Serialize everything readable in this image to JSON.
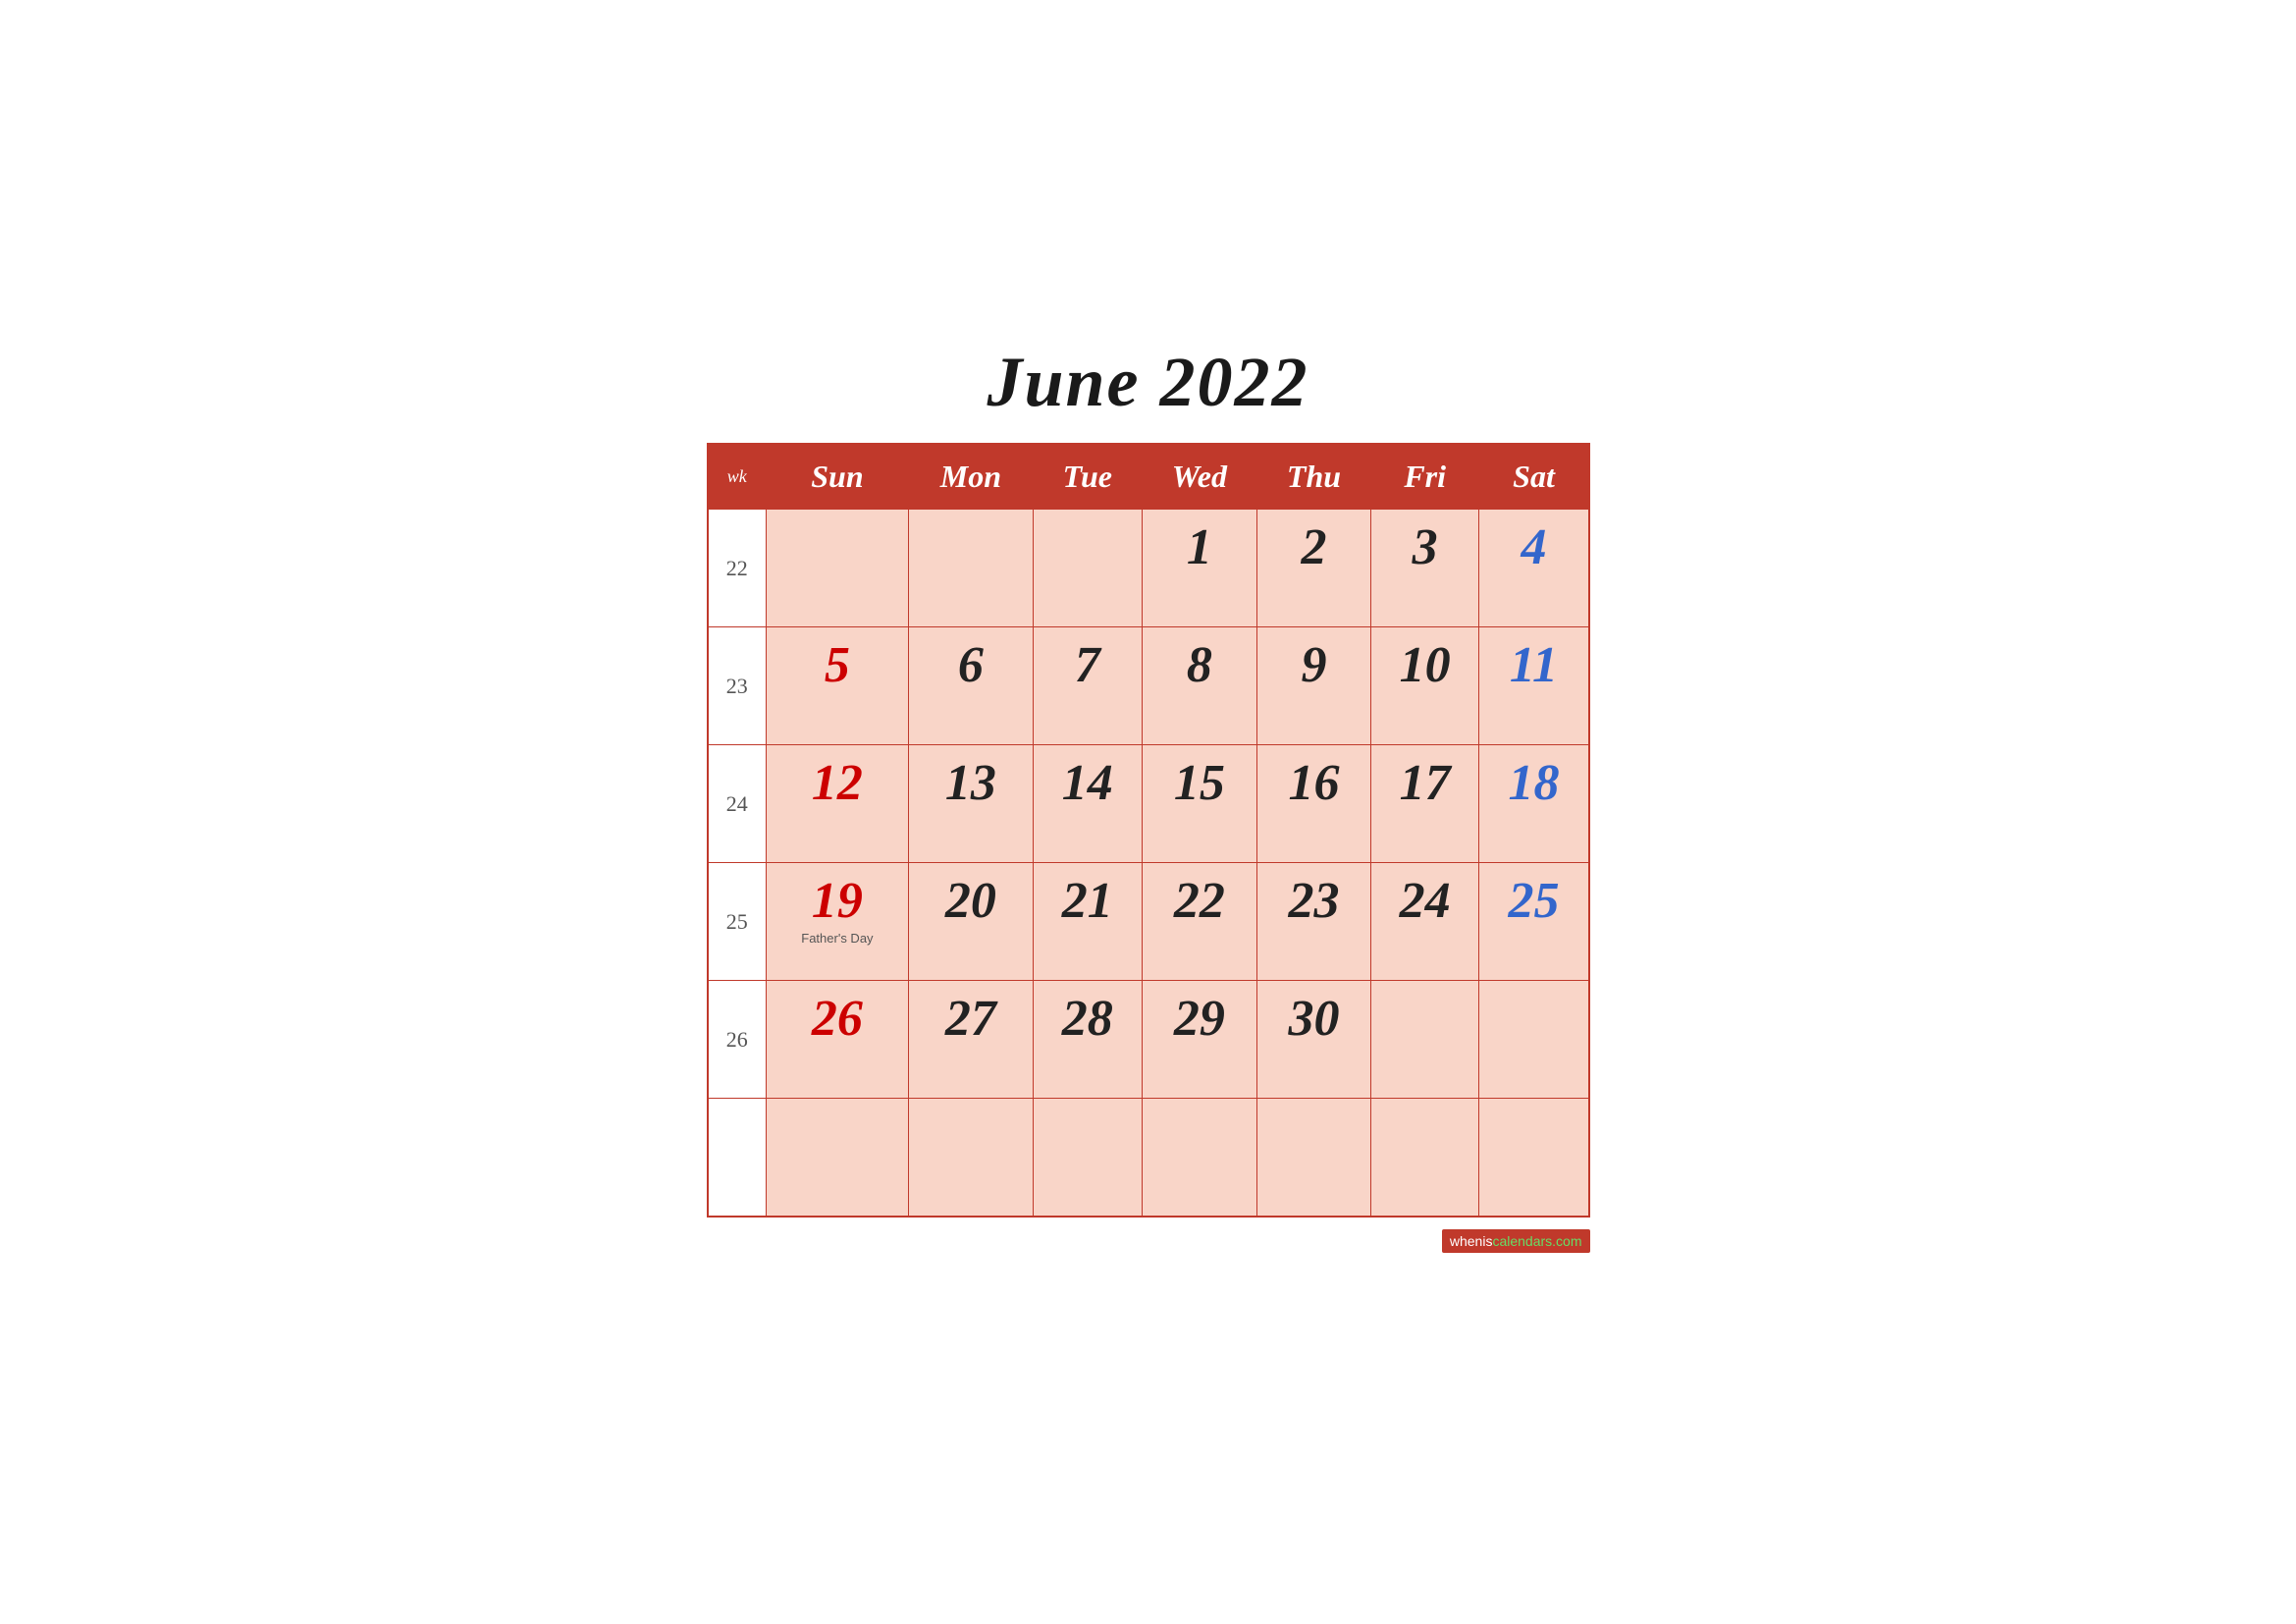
{
  "title": "June 2022",
  "header": {
    "wk": "wk",
    "days": [
      "Sun",
      "Mon",
      "Tue",
      "Wed",
      "Thu",
      "Fri",
      "Sat"
    ]
  },
  "weeks": [
    {
      "wk": "22",
      "days": [
        {
          "num": "",
          "color": "dark",
          "label": ""
        },
        {
          "num": "",
          "color": "dark",
          "label": ""
        },
        {
          "num": "",
          "color": "dark",
          "label": ""
        },
        {
          "num": "1",
          "color": "dark",
          "label": ""
        },
        {
          "num": "2",
          "color": "dark",
          "label": ""
        },
        {
          "num": "3",
          "color": "dark",
          "label": ""
        },
        {
          "num": "4",
          "color": "blue",
          "label": ""
        }
      ]
    },
    {
      "wk": "23",
      "days": [
        {
          "num": "5",
          "color": "red",
          "label": ""
        },
        {
          "num": "6",
          "color": "dark",
          "label": ""
        },
        {
          "num": "7",
          "color": "dark",
          "label": ""
        },
        {
          "num": "8",
          "color": "dark",
          "label": ""
        },
        {
          "num": "9",
          "color": "dark",
          "label": ""
        },
        {
          "num": "10",
          "color": "dark",
          "label": ""
        },
        {
          "num": "11",
          "color": "blue",
          "label": ""
        }
      ]
    },
    {
      "wk": "24",
      "days": [
        {
          "num": "12",
          "color": "red",
          "label": ""
        },
        {
          "num": "13",
          "color": "dark",
          "label": ""
        },
        {
          "num": "14",
          "color": "dark",
          "label": ""
        },
        {
          "num": "15",
          "color": "dark",
          "label": ""
        },
        {
          "num": "16",
          "color": "dark",
          "label": ""
        },
        {
          "num": "17",
          "color": "dark",
          "label": ""
        },
        {
          "num": "18",
          "color": "blue",
          "label": ""
        }
      ]
    },
    {
      "wk": "25",
      "days": [
        {
          "num": "19",
          "color": "red",
          "label": "Father's Day"
        },
        {
          "num": "20",
          "color": "dark",
          "label": ""
        },
        {
          "num": "21",
          "color": "dark",
          "label": ""
        },
        {
          "num": "22",
          "color": "dark",
          "label": ""
        },
        {
          "num": "23",
          "color": "dark",
          "label": ""
        },
        {
          "num": "24",
          "color": "dark",
          "label": ""
        },
        {
          "num": "25",
          "color": "blue",
          "label": ""
        }
      ]
    },
    {
      "wk": "26",
      "days": [
        {
          "num": "26",
          "color": "red",
          "label": ""
        },
        {
          "num": "27",
          "color": "dark",
          "label": ""
        },
        {
          "num": "28",
          "color": "dark",
          "label": ""
        },
        {
          "num": "29",
          "color": "dark",
          "label": ""
        },
        {
          "num": "30",
          "color": "dark",
          "label": ""
        },
        {
          "num": "",
          "color": "dark",
          "label": ""
        },
        {
          "num": "",
          "color": "dark",
          "label": ""
        }
      ]
    },
    {
      "wk": "",
      "days": [
        {
          "num": "",
          "color": "dark",
          "label": ""
        },
        {
          "num": "",
          "color": "dark",
          "label": ""
        },
        {
          "num": "",
          "color": "dark",
          "label": ""
        },
        {
          "num": "",
          "color": "dark",
          "label": ""
        },
        {
          "num": "",
          "color": "dark",
          "label": ""
        },
        {
          "num": "",
          "color": "dark",
          "label": ""
        },
        {
          "num": "",
          "color": "dark",
          "label": ""
        }
      ]
    }
  ],
  "footer": {
    "link_text": "wheniscalendars.com",
    "link_text_prefix": "whenis",
    "link_text_suffix": "calendars.com"
  }
}
